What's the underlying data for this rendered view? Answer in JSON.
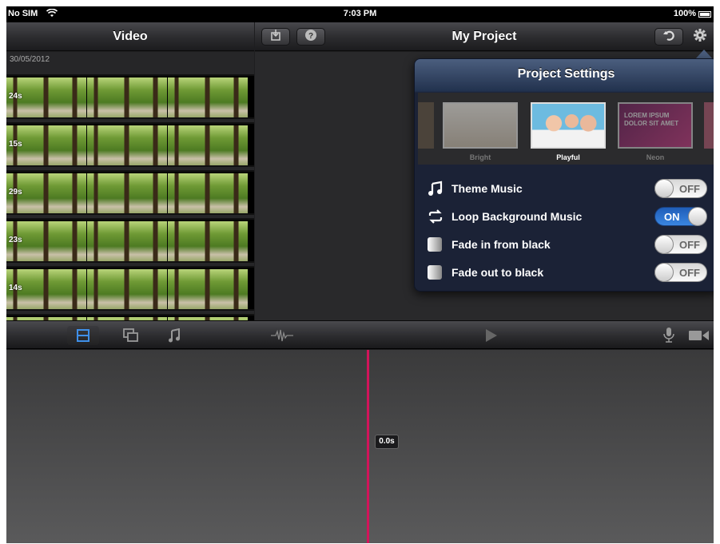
{
  "status_bar": {
    "carrier": "No SIM",
    "time": "7:03 PM",
    "battery": "100%"
  },
  "left_panel": {
    "title": "Video",
    "date": "30/05/2012",
    "clips": [
      {
        "duration": "24s"
      },
      {
        "duration": "15s"
      },
      {
        "duration": "29s"
      },
      {
        "duration": "23s"
      },
      {
        "duration": "14s"
      }
    ]
  },
  "project": {
    "title": "My Project"
  },
  "popover": {
    "title": "Project Settings",
    "themes": [
      {
        "label": "Bright"
      },
      {
        "label": "Playful",
        "selected": true
      },
      {
        "label": "Neon",
        "thumb_text": "LOREM IPSUM DOLOR SIT AMET"
      }
    ],
    "settings": [
      {
        "label": "Theme Music",
        "icon": "music-note-icon",
        "state": "OFF"
      },
      {
        "label": "Loop Background Music",
        "icon": "loop-icon",
        "state": "ON"
      },
      {
        "label": "Fade in from black",
        "icon": "fade-in-icon",
        "state": "OFF"
      },
      {
        "label": "Fade out to black",
        "icon": "fade-out-icon",
        "state": "OFF"
      }
    ]
  },
  "timeline": {
    "playhead_time": "0.0s"
  },
  "colors": {
    "playhead": "#d2145a",
    "toggle_on": "#2f73d0",
    "popover_header": "#3a4d6d"
  }
}
